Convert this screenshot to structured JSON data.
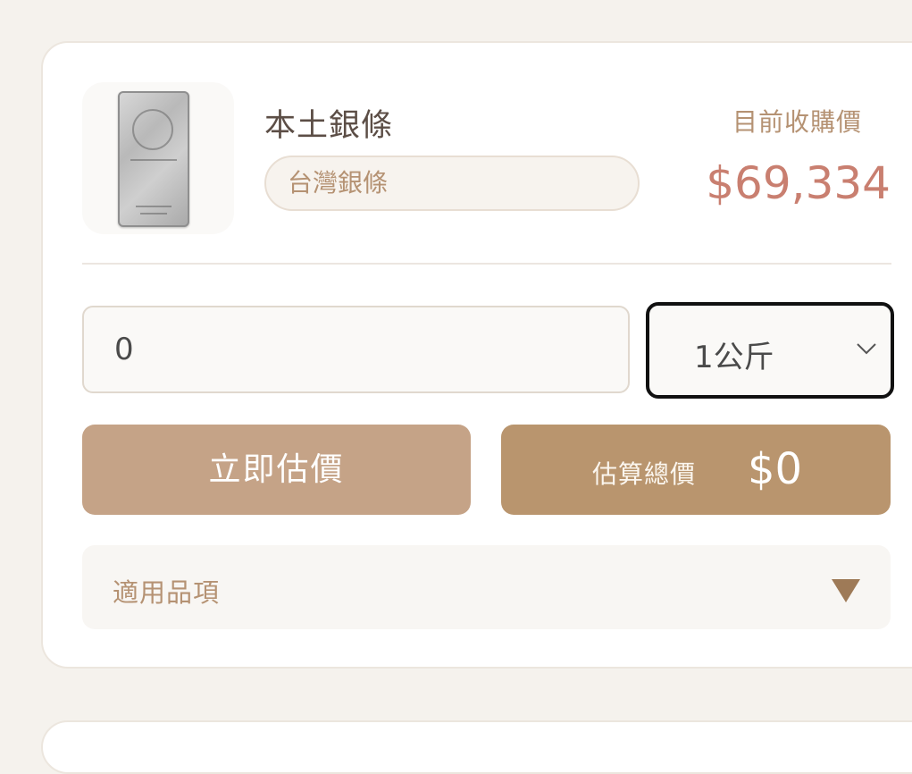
{
  "product": {
    "name": "本土銀條",
    "tag": "台灣銀條",
    "image_alt": "silver bar"
  },
  "price": {
    "label": "目前收購價",
    "value": "$69,334"
  },
  "form": {
    "quantity_value": "0",
    "unit_selected": "1公斤"
  },
  "actions": {
    "estimate_label": "立即估價",
    "total_label": "估算總價",
    "total_value": "$0"
  },
  "accordion": {
    "label": "適用品項"
  },
  "colors": {
    "accent": "#b59273",
    "price": "#c97f70",
    "button_primary": "#c5a387",
    "button_total": "#b9956e"
  }
}
